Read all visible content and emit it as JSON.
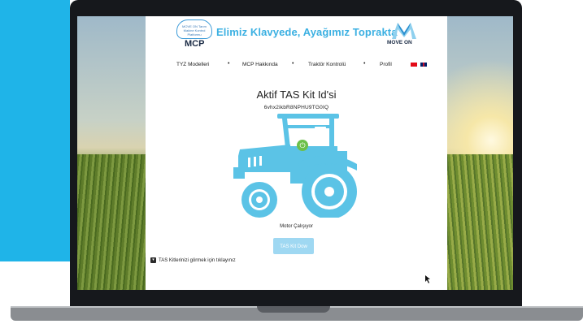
{
  "header": {
    "mcp_logo_text": "MCP",
    "mcp_cloud_text": "MOVE ON Tarım Makine Kontrol Platformu",
    "slogan": "Elimiz Klavyede, Ayağımız Toprakta",
    "move_on_logo_text": "MOVE ON"
  },
  "nav": {
    "items": [
      {
        "label": "TYZ Modelleri"
      },
      {
        "label": "MCP Hakkında"
      },
      {
        "label": "Traktör Kontrolü"
      },
      {
        "label": "Profil"
      }
    ],
    "separator": "•",
    "languages": [
      "tr-flag-icon",
      "uk-flag-icon"
    ]
  },
  "main": {
    "title": "Aktif TAS Kit Id'si",
    "kit_id": "6vhx2ikbR8NPHU9TG0IQ",
    "power_icon": "⏻",
    "status": "Motor Çalışıyor",
    "button_label": "TAS Kit Dow",
    "toggle_label": "TAS Kitlerinizi görmek için tıklayınız",
    "toggle_icon": "▾"
  },
  "colors": {
    "accent": "#1fb4e8",
    "tractor": "#5bc3e6",
    "power": "#6cc04a",
    "button": "#9fd8f2",
    "slogan": "#3bb0e2"
  }
}
